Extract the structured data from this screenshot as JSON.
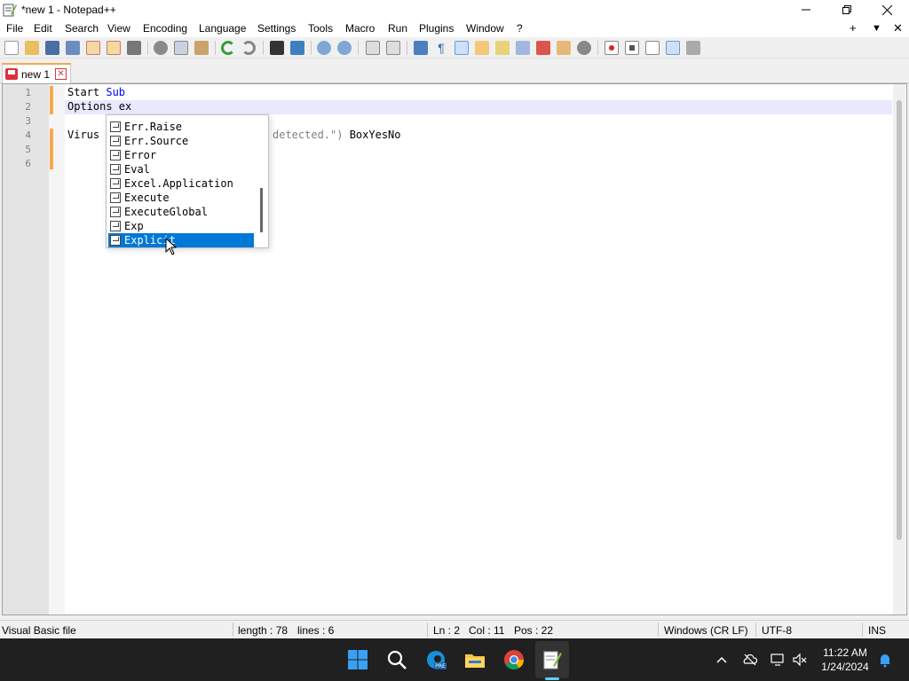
{
  "window": {
    "title": "*new 1 - Notepad++"
  },
  "menu": {
    "items": [
      "File",
      "Edit",
      "Search",
      "View",
      "Encoding",
      "Language",
      "Settings",
      "Tools",
      "Macro",
      "Run",
      "Plugins",
      "Window",
      "?"
    ],
    "right": [
      "+",
      "▼",
      "✕"
    ]
  },
  "tab": {
    "label": "new 1"
  },
  "editor": {
    "line_numbers": [
      "1",
      "2",
      "3",
      "4",
      "5",
      "6"
    ],
    "lines": {
      "l1_a": "Start ",
      "l1_b": "Sub",
      "l2": "Options ex",
      "l4_a": "Virus",
      "l4_b": "detected.\")",
      "l4_c": " BoxYesNo"
    }
  },
  "autocomplete": {
    "items": [
      "Err.Raise",
      "Err.Source",
      "Error",
      "Eval",
      "Excel.Application",
      "Execute",
      "ExecuteGlobal",
      "Exp",
      "Explicit"
    ],
    "selected": "Explicit"
  },
  "status": {
    "language": "Visual Basic file",
    "length": "length : 78",
    "lines": "lines : 6",
    "ln": "Ln : 2",
    "col": "Col : 11",
    "pos": "Pos : 22",
    "eol": "Windows (CR LF)",
    "encoding": "UTF-8",
    "mode": "INS"
  },
  "taskbar": {
    "time": "11:22 AM",
    "date": "1/24/2024",
    "edge_badge": "PRE"
  },
  "colors": {
    "accent": "#0078d7",
    "keyword": "#0000ff",
    "changed": "#f7a84d"
  }
}
